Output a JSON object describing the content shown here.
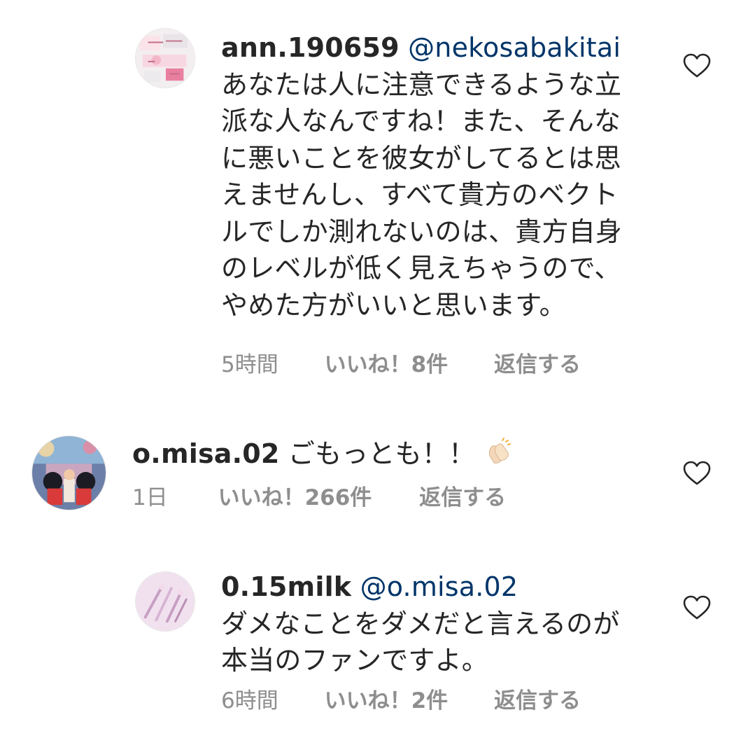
{
  "comments": [
    {
      "username": "ann.190659",
      "mention": "@nekosabakitai",
      "text": " あなたは人に注意できるような立派な人なんですね！また、そんなに悪いことを彼女がしてるとは思えませんし、すべて貴方のベクトルでしか測れないのは、貴方自身のレベルが低く見えちゃうので、やめた方がいいと思います。",
      "time": "5時間",
      "likes": "いいね！8件",
      "reply": "返信する",
      "avatar_icon": "avatar-image",
      "like_icon": "heart-outline-icon"
    },
    {
      "username": "o.misa.02",
      "mention": "",
      "text": " ごもっとも！！",
      "emoji": "clapping-hands-emoji",
      "time": "1日",
      "likes": "いいね！266件",
      "reply": "返信する",
      "avatar_icon": "avatar-image",
      "like_icon": "heart-outline-icon"
    },
    {
      "username": "0.15milk",
      "mention": "@o.misa.02",
      "text": "ダメなことをダメだと言えるのが本当のファンですよ。",
      "time": "6時間",
      "likes": "いいね！2件",
      "reply": "返信する",
      "avatar_icon": "avatar-image",
      "like_icon": "heart-outline-icon"
    }
  ],
  "colors": {
    "text": "#262626",
    "mention": "#003569",
    "meta": "#8e8e8e",
    "background": "#ffffff"
  }
}
